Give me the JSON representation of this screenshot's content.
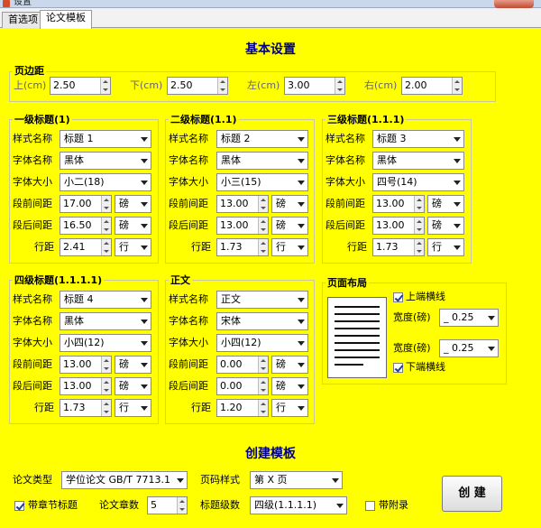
{
  "window": {
    "title": "设置"
  },
  "tabs": [
    "首选项",
    "论文模板"
  ],
  "basic": {
    "title": "基本设置",
    "margins": {
      "title": "页边距",
      "top_label": "上(cm)",
      "top_value": "2.50",
      "bottom_label": "下(cm)",
      "bottom_value": "2.50",
      "left_label": "左(cm)",
      "left_value": "3.00",
      "right_label": "右(cm)",
      "right_value": "2.00"
    },
    "labels": {
      "style_name": "样式名称",
      "font_name": "字体名称",
      "font_size": "字体大小",
      "space_before": "段前间距",
      "space_after": "段后间距",
      "line_spacing": "行距"
    },
    "h1": {
      "title": "一级标题(1)",
      "style": "标题 1",
      "font": "黑体",
      "size": "小二(18)",
      "before": "17.00",
      "before_unit": "磅",
      "after": "16.50",
      "after_unit": "磅",
      "line": "2.41",
      "line_unit": "行"
    },
    "h2": {
      "title": "二级标题(1.1)",
      "style": "标题 2",
      "font": "黑体",
      "size": "小三(15)",
      "before": "13.00",
      "before_unit": "磅",
      "after": "13.00",
      "after_unit": "磅",
      "line": "1.73",
      "line_unit": "行"
    },
    "h3": {
      "title": "三级标题(1.1.1)",
      "style": "标题 3",
      "font": "黑体",
      "size": "四号(14)",
      "before": "13.00",
      "before_unit": "磅",
      "after": "13.00",
      "after_unit": "磅",
      "line": "1.73",
      "line_unit": "行"
    },
    "h4": {
      "title": "四级标题(1.1.1.1)",
      "style": "标题 4",
      "font": "黑体",
      "size": "小四(12)",
      "before": "13.00",
      "before_unit": "磅",
      "after": "13.00",
      "after_unit": "磅",
      "line": "1.73",
      "line_unit": "行"
    },
    "body": {
      "title": "正文",
      "style": "正文",
      "font": "宋体",
      "size": "小四(12)",
      "before": "0.00",
      "before_unit": "磅",
      "after": "0.00",
      "after_unit": "磅",
      "line": "1.20",
      "line_unit": "行"
    },
    "layout": {
      "title": "页面布局",
      "top_line_label": "上端横线",
      "top_line_checked": true,
      "width_label": "宽度(磅)",
      "top_width": "_ 0.25",
      "bottom_width": "_ 0.25",
      "bottom_line_label": "下端横线",
      "bottom_line_checked": true
    }
  },
  "create": {
    "title": "创建模板",
    "paper_type_label": "论文类型",
    "paper_type": "学位论文 GB/T 7713.1",
    "page_num_label": "页码样式",
    "page_num": "第 X 页",
    "chapter_title_label": "带章节标题",
    "chapter_title_checked": true,
    "chapters_label": "论文章数",
    "chapters": "5",
    "heading_levels_label": "标题级数",
    "heading_levels": "四级(1.1.1.1)",
    "appendix_label": "带附录",
    "appendix_checked": false,
    "create_button": "创 建"
  }
}
